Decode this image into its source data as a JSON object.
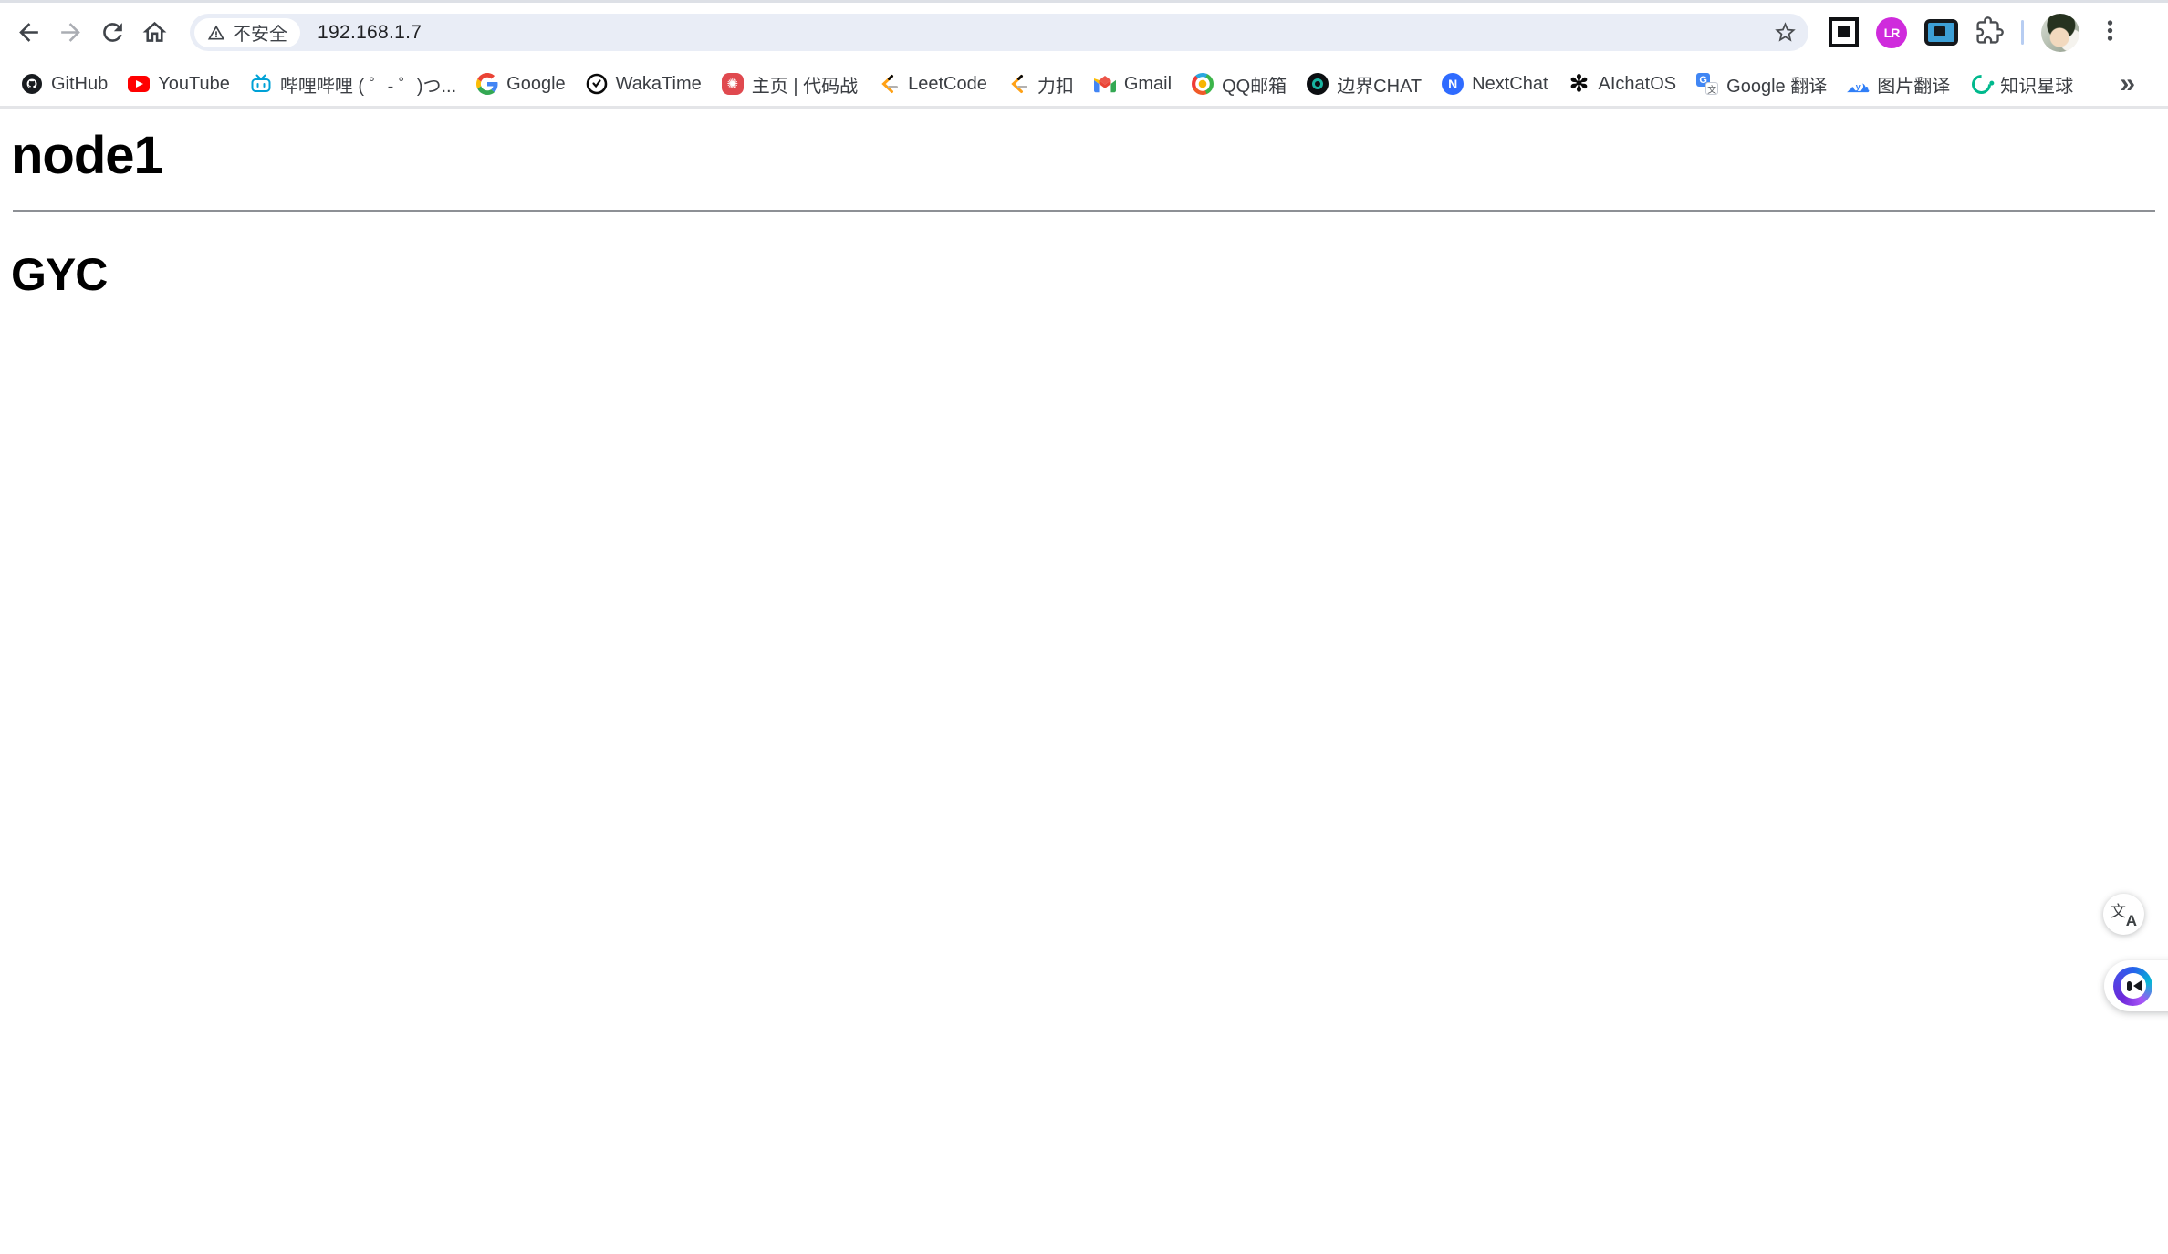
{
  "browser": {
    "toolbar": {
      "url": "192.168.1.7",
      "security_label": "不安全"
    },
    "bookmarks": [
      {
        "label": "GitHub",
        "icon": "github"
      },
      {
        "label": "YouTube",
        "icon": "youtube"
      },
      {
        "label": "哔哩哔哩 ( ゜- ゜)つ...",
        "icon": "bilibili"
      },
      {
        "label": "Google",
        "icon": "google"
      },
      {
        "label": "WakaTime",
        "icon": "wakatime"
      },
      {
        "label": "主页 | 代码战",
        "icon": "codewar"
      },
      {
        "label": "LeetCode",
        "icon": "leetcode"
      },
      {
        "label": "力扣",
        "icon": "leetcode"
      },
      {
        "label": "Gmail",
        "icon": "gmail"
      },
      {
        "label": "QQ邮箱",
        "icon": "qqmail"
      },
      {
        "label": "边界CHAT",
        "icon": "bianjie-chat"
      },
      {
        "label": "NextChat",
        "icon": "nextchat"
      },
      {
        "label": "AIchatOS",
        "icon": "aichatos"
      },
      {
        "label": "Google 翻译",
        "icon": "google-translate"
      },
      {
        "label": "图片翻译",
        "icon": "image-translate"
      },
      {
        "label": "知识星球",
        "icon": "zhishixingqiu"
      }
    ],
    "bookmarks_overflow": "»",
    "extensions": [
      {
        "name": "square-extension"
      },
      {
        "name": "LR-extension",
        "monogram": "LR"
      },
      {
        "name": "picture-in-picture-extension"
      }
    ],
    "nextchat_monogram": "N",
    "aichatos_glyph": "✻",
    "gtranslate_g": "G",
    "gtranslate_wen": "文",
    "imgtrans_cloud": "☁",
    "imgtrans_mark": "y",
    "codewar_glyph": "✺"
  },
  "page": {
    "heading1": "node1",
    "heading2": "GYC"
  },
  "fab": {
    "translate_zh": "文",
    "translate_en": "A"
  },
  "colors": {
    "omnibox_bg": "#e9edf6",
    "bookmark_text": "#3b3e43",
    "url_text": "#202124",
    "bilibili_blue": "#00a1d6",
    "youtube_red": "#ff0000",
    "leetcode_orange": "#ffa116",
    "nextchat_blue": "#2f6bff",
    "zhishixingqiu_green": "#00b98d",
    "assistant_gradient": [
      "#6d28d9",
      "#2563eb",
      "#06b6d4",
      "#a855f7"
    ]
  }
}
